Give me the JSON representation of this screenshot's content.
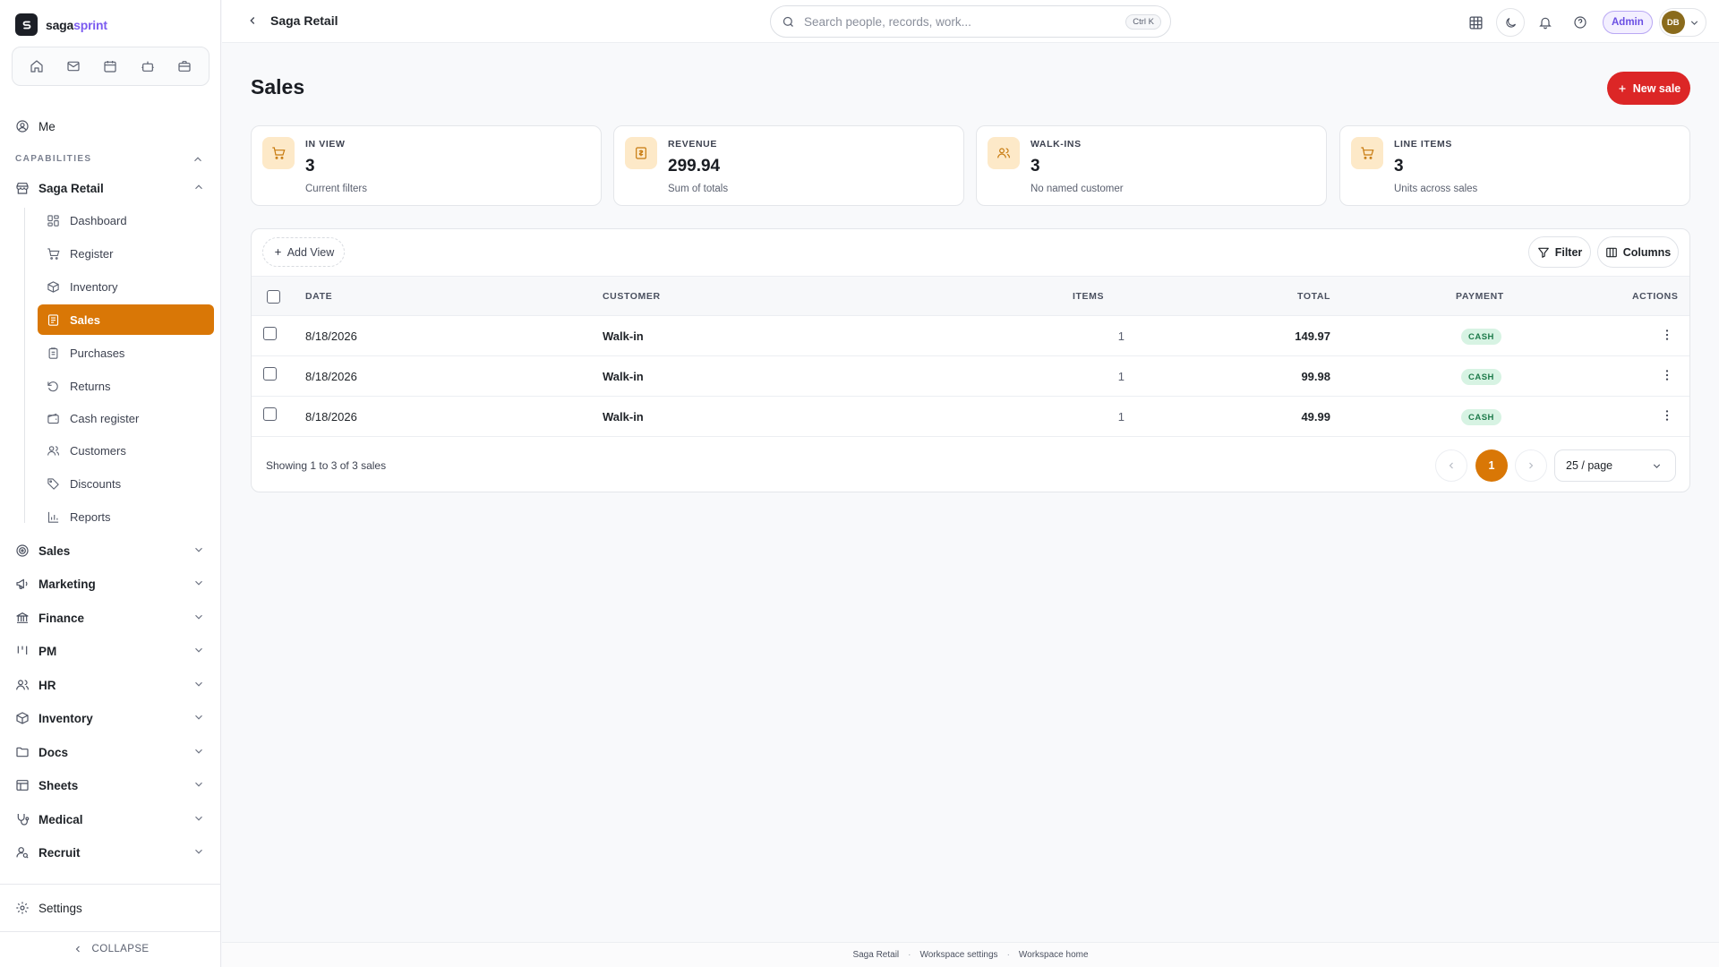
{
  "brand": {
    "name_part1": "saga",
    "name_part2": "sprint",
    "logo_letter": "S"
  },
  "quick_bar": {
    "items": [
      "home-icon",
      "mail-icon",
      "calendar-icon",
      "bot-icon",
      "briefcase-icon"
    ]
  },
  "sidebar": {
    "me_label": "Me",
    "section_label": "CAPABILITIES",
    "group_label": "Saga Retail",
    "sub_items": [
      {
        "label": "Dashboard",
        "icon": "grid-icon"
      },
      {
        "label": "Register",
        "icon": "cart-icon"
      },
      {
        "label": "Inventory",
        "icon": "box-icon"
      },
      {
        "label": "Sales",
        "icon": "receipt-icon",
        "active": true
      },
      {
        "label": "Purchases",
        "icon": "clipboard-icon"
      },
      {
        "label": "Returns",
        "icon": "rotate-ccw-icon"
      },
      {
        "label": "Cash register",
        "icon": "wallet-icon"
      },
      {
        "label": "Customers",
        "icon": "users-icon"
      },
      {
        "label": "Discounts",
        "icon": "tag-icon"
      },
      {
        "label": "Reports",
        "icon": "bar-chart-icon"
      }
    ],
    "modules": [
      {
        "label": "Sales",
        "icon": "target-icon"
      },
      {
        "label": "Marketing",
        "icon": "megaphone-icon"
      },
      {
        "label": "Finance",
        "icon": "bank-icon"
      },
      {
        "label": "PM",
        "icon": "kanban-icon"
      },
      {
        "label": "HR",
        "icon": "users-icon"
      },
      {
        "label": "Inventory",
        "icon": "box-icon"
      },
      {
        "label": "Docs",
        "icon": "folder-icon"
      },
      {
        "label": "Sheets",
        "icon": "table-icon"
      },
      {
        "label": "Medical",
        "icon": "stethoscope-icon"
      },
      {
        "label": "Recruit",
        "icon": "user-search-icon"
      }
    ],
    "settings_label": "Settings",
    "collapse_label": "COLLAPSE"
  },
  "topbar": {
    "breadcrumb": "Saga Retail",
    "search_placeholder": "Search people, records, work...",
    "search_shortcut": "Ctrl K",
    "admin_label": "Admin",
    "avatar_initials": "DB"
  },
  "page": {
    "title": "Sales",
    "new_button": "New sale"
  },
  "stats": [
    {
      "label": "IN VIEW",
      "value": "3",
      "sub": "Current filters",
      "icon": "cart-icon"
    },
    {
      "label": "REVENUE",
      "value": "299.94",
      "sub": "Sum of totals",
      "icon": "receipt-icon"
    },
    {
      "label": "WALK-INS",
      "value": "3",
      "sub": "No named customer",
      "icon": "users-icon"
    },
    {
      "label": "LINE ITEMS",
      "value": "3",
      "sub": "Units across sales",
      "icon": "cart-icon"
    }
  ],
  "toolbar": {
    "add_view": "Add View",
    "filter": "Filter",
    "columns": "Columns"
  },
  "table": {
    "headers": {
      "date": "DATE",
      "customer": "CUSTOMER",
      "items": "ITEMS",
      "total": "TOTAL",
      "payment": "PAYMENT",
      "actions": "ACTIONS"
    },
    "rows": [
      {
        "date": "8/18/2026",
        "customer": "Walk-in",
        "items": "1",
        "total": "149.97",
        "payment": "CASH"
      },
      {
        "date": "8/18/2026",
        "customer": "Walk-in",
        "items": "1",
        "total": "99.98",
        "payment": "CASH"
      },
      {
        "date": "8/18/2026",
        "customer": "Walk-in",
        "items": "1",
        "total": "49.99",
        "payment": "CASH"
      }
    ]
  },
  "pagination": {
    "summary": "Showing 1 to 3 of 3 sales",
    "current_page": "1",
    "per_page": "25 / page"
  },
  "footer": {
    "links": [
      "Saga Retail",
      "Workspace settings",
      "Workspace home"
    ],
    "separator": "·"
  },
  "colors": {
    "accent_orange": "#d97706",
    "primary_red": "#dc2626",
    "admin_purple": "#6a4fe3",
    "cash_green": "#1d7a4a"
  }
}
